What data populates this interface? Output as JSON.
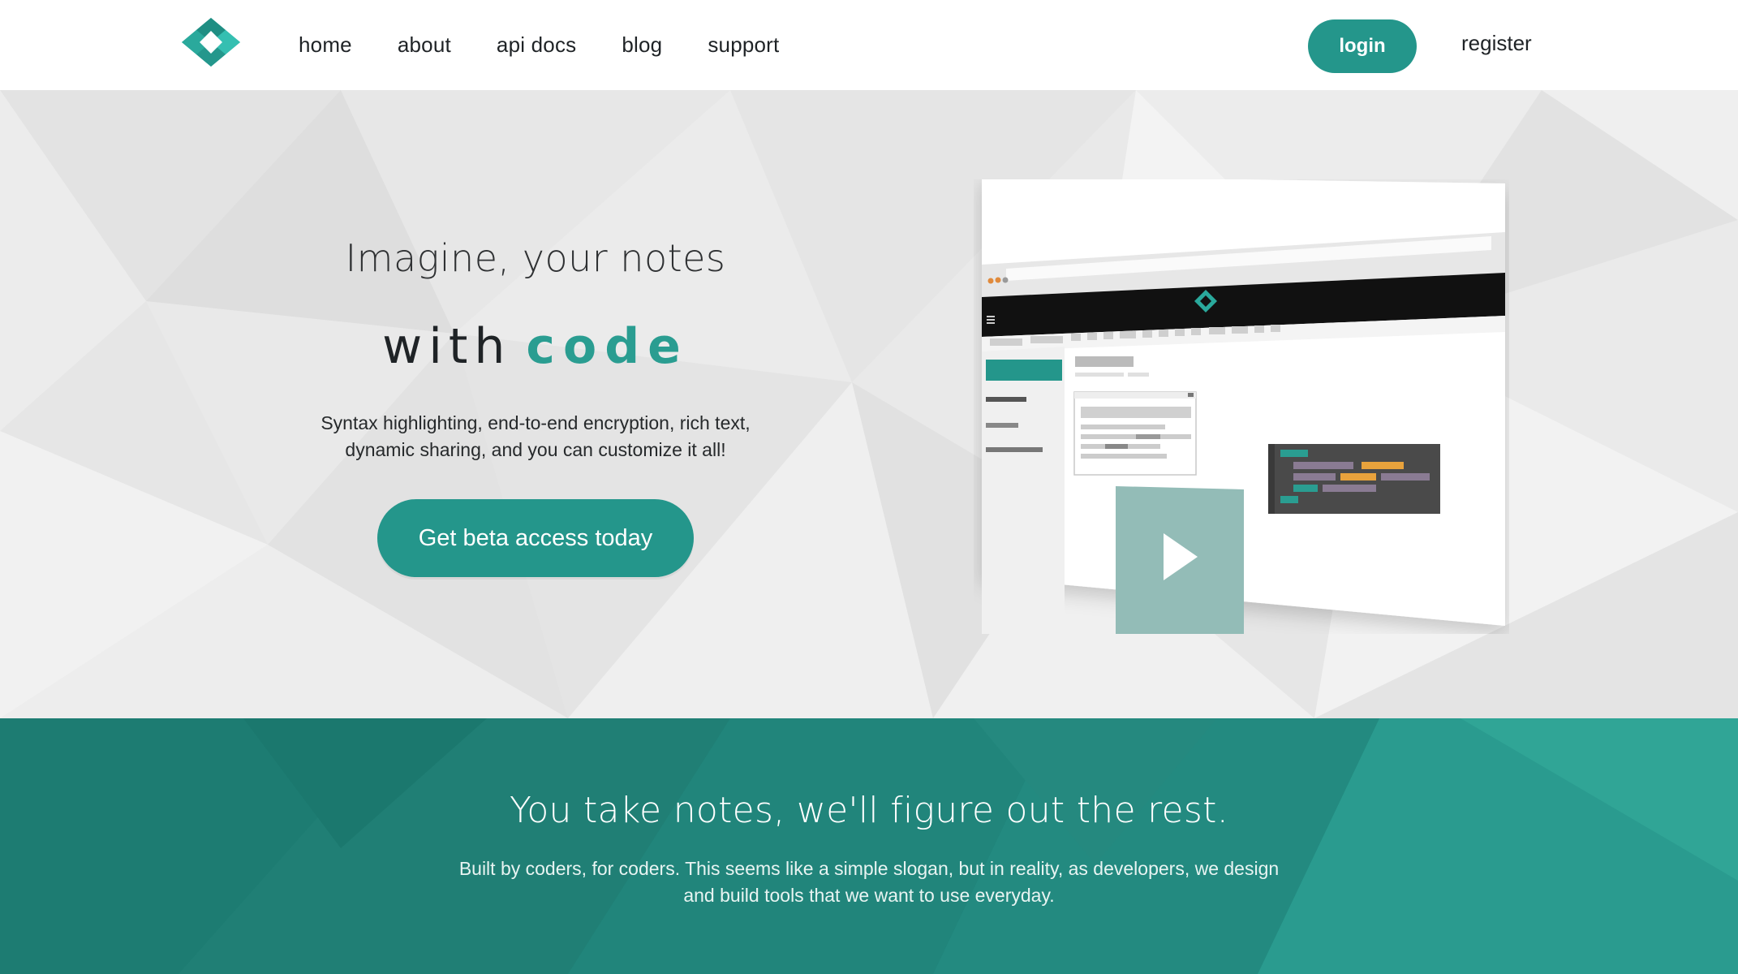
{
  "nav": {
    "logo_name": "diamond-logo",
    "links": [
      "home",
      "about",
      "api docs",
      "blog",
      "support"
    ],
    "login_label": "login",
    "register_label": "register"
  },
  "hero": {
    "title": "Imagine, your notes",
    "with_word": "with",
    "code_word": "code",
    "description_line1": "Syntax highlighting, end-to-end encryption, rich text,",
    "description_line2": "dynamic sharing, and you can customize it all!",
    "cta_label": "Get beta access today"
  },
  "feature": {
    "title": "You take notes, we'll figure out the rest.",
    "description_line1": "Built by coders, for coders. This seems like a simple slogan, but in reality, as developers, we design",
    "description_line2": "and build tools that we want to use everyday."
  },
  "colors": {
    "accent": "#24968b",
    "accent_dark": "#1f8278",
    "text_dark": "#1f2326",
    "hero_bg": "#e9e9e9",
    "code_orange": "#e8a23c",
    "code_purple": "#8a7b93"
  }
}
